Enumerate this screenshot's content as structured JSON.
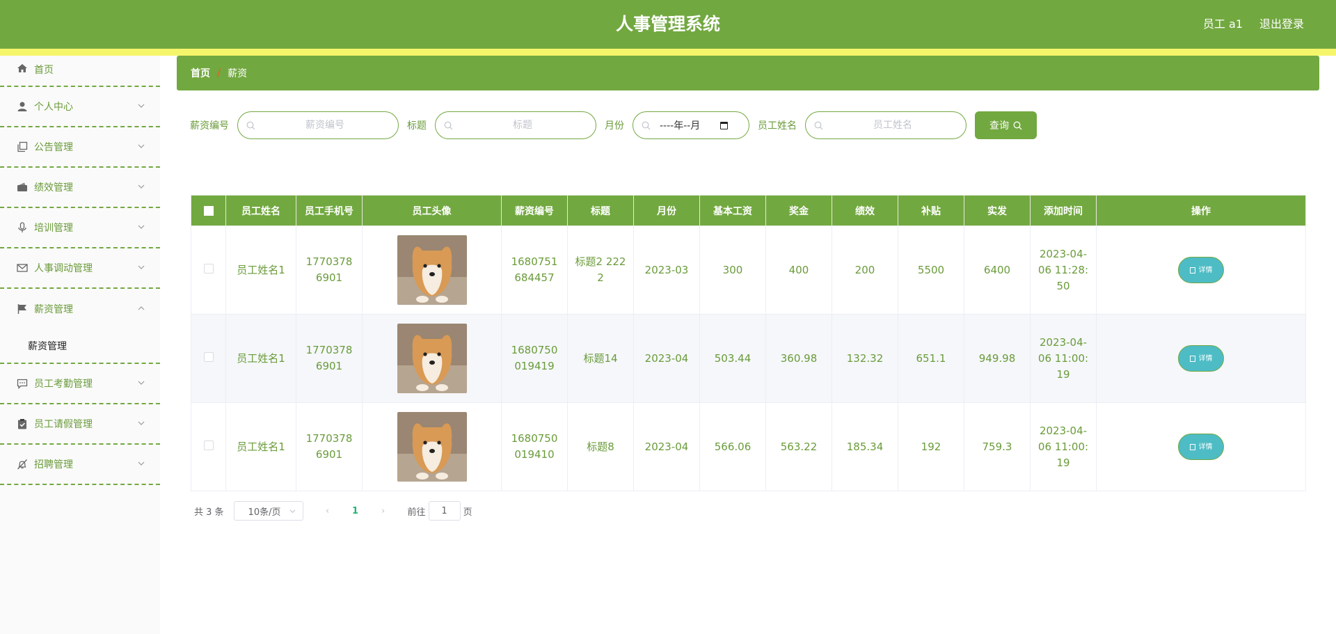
{
  "header": {
    "title": "人事管理系统",
    "user": "员工 a1",
    "logout": "退出登录",
    "color": "#72a840",
    "stripe_color": "#f5f56b"
  },
  "sidebar": {
    "items": [
      {
        "label": "首页",
        "icon": "home-icon"
      },
      {
        "label": "个人中心",
        "icon": "user-icon"
      },
      {
        "label": "公告管理",
        "icon": "copy-icon"
      },
      {
        "label": "绩效管理",
        "icon": "wallet-icon"
      },
      {
        "label": "培训管理",
        "icon": "microphone-icon"
      },
      {
        "label": "人事调动管理",
        "icon": "mail-icon"
      },
      {
        "label": "薪资管理",
        "icon": "flag-icon",
        "sub": "薪资管理"
      },
      {
        "label": "员工考勤管理",
        "icon": "chat-icon"
      },
      {
        "label": "员工请假管理",
        "icon": "clipboard-icon"
      },
      {
        "label": "招聘管理",
        "icon": "bell-off-icon"
      }
    ]
  },
  "breadcrumb": {
    "home": "首页",
    "separator": "/",
    "current": "薪资"
  },
  "search": {
    "salary_no_label": "薪资编号",
    "salary_no_placeholder": "薪资编号",
    "title_label": "标题",
    "title_placeholder": "标题",
    "month_label": "月份",
    "month_value": "----年--月",
    "name_label": "员工姓名",
    "name_placeholder": "员工姓名",
    "query_label": "查询"
  },
  "table": {
    "columns": [
      "员工姓名",
      "员工手机号",
      "员工头像",
      "薪资编号",
      "标题",
      "月份",
      "基本工资",
      "奖金",
      "绩效",
      "补贴",
      "实发",
      "添加时间",
      "操作"
    ],
    "rows": [
      {
        "name": "员工姓名1",
        "phone": "17703786901",
        "salary_no": "1680751684457",
        "title": "标题2 2222",
        "month": "2023-03",
        "base": "300",
        "bonus": "400",
        "perf": "200",
        "allowance": "5500",
        "actual": "6400",
        "time": "2023-04-06 11:28:50",
        "action": "详情"
      },
      {
        "name": "员工姓名1",
        "phone": "17703786901",
        "salary_no": "1680750019419",
        "title": "标题14",
        "month": "2023-04",
        "base": "503.44",
        "bonus": "360.98",
        "perf": "132.32",
        "allowance": "651.1",
        "actual": "949.98",
        "time": "2023-04-06 11:00:19",
        "action": "详情"
      },
      {
        "name": "员工姓名1",
        "phone": "17703786901",
        "salary_no": "1680750019410",
        "title": "标题8",
        "month": "2023-04",
        "base": "566.06",
        "bonus": "563.22",
        "perf": "185.34",
        "allowance": "192",
        "actual": "759.3",
        "time": "2023-04-06 11:00:19",
        "action": "详情"
      }
    ]
  },
  "pagination": {
    "total": "共 3 条",
    "page_size": "10条/页",
    "prev": "‹",
    "current_page": "1",
    "next": "›",
    "goto_prefix": "前往",
    "goto_value": "1",
    "goto_suffix": "页"
  }
}
